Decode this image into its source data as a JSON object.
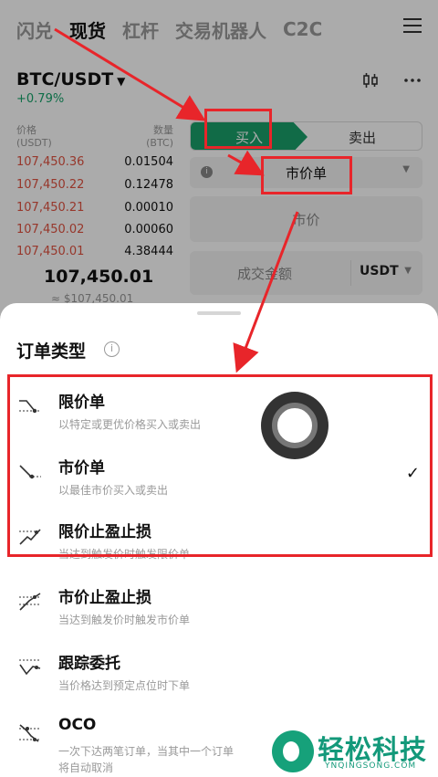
{
  "nav": {
    "tabs": [
      "闪兑",
      "现货",
      "杠杆",
      "交易机器人",
      "C2C"
    ],
    "active_tab": "现货",
    "menu_icon": "hamburger-menu-icon"
  },
  "market": {
    "pair": "BTC/USDT",
    "change": "+0.79%",
    "change_color": "#15a36a",
    "chart_icon": "candlestick-icon",
    "more_icon": "more-dots-icon"
  },
  "orderbook": {
    "price_header": "价格",
    "price_unit": "(USDT)",
    "qty_header": "数量",
    "qty_unit": "(BTC)",
    "asks": [
      {
        "price": "107,450.36",
        "qty": "0.01504"
      },
      {
        "price": "107,450.22",
        "qty": "0.12478"
      },
      {
        "price": "107,450.21",
        "qty": "0.00010"
      },
      {
        "price": "107,450.02",
        "qty": "0.00060"
      },
      {
        "price": "107,450.01",
        "qty": "4.38444"
      }
    ],
    "ask_color": "#e15241",
    "last_price": "107,450.01",
    "last_price_usd": "≈ $107,450.01"
  },
  "form": {
    "buy_label": "买入",
    "sell_label": "卖出",
    "buy_color": "#1aa06b",
    "order_type": "市价单",
    "market_price_label": "市价",
    "amount_label": "成交金额",
    "amount_unit": "USDT"
  },
  "sheet": {
    "title": "订单类型",
    "options": [
      {
        "name": "限价单",
        "desc": "以特定或更优价格买入或卖出",
        "icon": "limit-order-icon",
        "selected": false
      },
      {
        "name": "市价单",
        "desc": "以最佳市价买入或卖出",
        "icon": "market-order-icon",
        "selected": true
      },
      {
        "name": "限价止盈止损",
        "desc": "当达到触发价时触发限价单",
        "icon": "limit-tpsl-icon",
        "selected": false
      },
      {
        "name": "市价止盈止损",
        "desc": "当达到触发价时触发市价单",
        "icon": "market-tpsl-icon",
        "selected": false
      },
      {
        "name": "跟踪委托",
        "desc": "当价格达到预定点位时下单",
        "icon": "trailing-order-icon",
        "selected": false
      },
      {
        "name": "OCO",
        "desc": "一次下达两笔订单，当其中一个订单",
        "desc2": "将自动取消",
        "icon": "oco-icon",
        "selected": false
      }
    ],
    "check_glyph": "✓"
  },
  "annotation": {
    "highlight_color": "#e8252a"
  },
  "watermark": {
    "brand": "轻松科技",
    "site": "YNQINGSONG.COM",
    "color": "#13997a"
  }
}
